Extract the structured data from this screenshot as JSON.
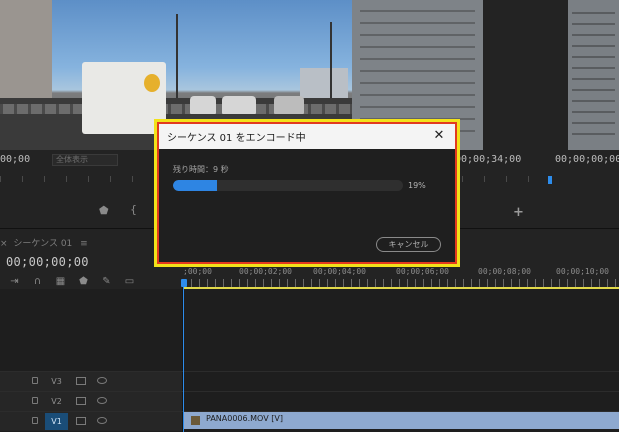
{
  "program_monitor": {
    "timecode_left": "00;00",
    "timecode_right": "00;00;34;00",
    "fit_select": "全体表示"
  },
  "source_monitor": {
    "timecode": "00;00;00;00"
  },
  "timeline": {
    "tab_label": "シーケンス 01",
    "tab_close": "×",
    "tab_menu": "≡",
    "timecode": "00;00;00;00",
    "ruler": [
      ";00;00",
      "00;00;02;00",
      "00;00;04;00",
      "00;00;06;00",
      "00;00;08;00",
      "00;00;10;00"
    ],
    "tracks": [
      {
        "name": "V3",
        "active": false
      },
      {
        "name": "V2",
        "active": false
      },
      {
        "name": "V1",
        "active": true
      }
    ],
    "clip_name": "PANA0006.MOV [V]"
  },
  "dialog": {
    "title": "シーケンス 01 をエンコード中",
    "close_glyph": "✕",
    "remaining_label": "残り時間：9 秒",
    "progress_percent": 19,
    "progress_text": "19%",
    "cancel_label": "キャンセル"
  },
  "colors": {
    "accent": "#2e85e3",
    "highlight_outer": "#f2e21a",
    "highlight_inner": "#e23a1e",
    "workarea": "#e0d84a",
    "clip": "#8ea9cf"
  }
}
